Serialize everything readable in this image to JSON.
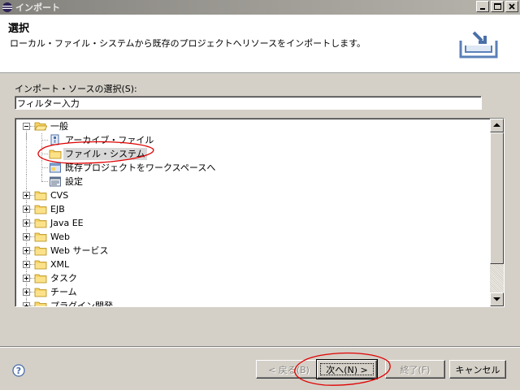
{
  "window": {
    "title": "インポート",
    "minimize_label": "_",
    "maximize_label": "□",
    "close_label": "X"
  },
  "banner": {
    "title": "選択",
    "description": "ローカル・ファイル・システムから既存のプロジェクトへリソースをインポートします。"
  },
  "source": {
    "label": "インポート・ソースの選択(S):",
    "filter_value": "フィルター入力"
  },
  "tree": {
    "items": [
      {
        "label": "一般",
        "icon": "folder-open-icon",
        "level": 0,
        "expanded": true
      },
      {
        "label": "アーカイブ・ファイル",
        "icon": "archive-file-icon",
        "level": 1
      },
      {
        "label": "ファイル・システム",
        "icon": "folder-icon",
        "level": 1,
        "selected": true
      },
      {
        "label": "既存プロジェクトをワークスペースへ",
        "icon": "project-icon",
        "level": 1
      },
      {
        "label": "設定",
        "icon": "settings-icon",
        "level": 1
      },
      {
        "label": "CVS",
        "icon": "folder-icon",
        "level": 0,
        "expanded": false
      },
      {
        "label": "EJB",
        "icon": "folder-icon",
        "level": 0,
        "expanded": false
      },
      {
        "label": "Java EE",
        "icon": "folder-icon",
        "level": 0,
        "expanded": false
      },
      {
        "label": "Web",
        "icon": "folder-icon",
        "level": 0,
        "expanded": false
      },
      {
        "label": "Web サービス",
        "icon": "folder-icon",
        "level": 0,
        "expanded": false
      },
      {
        "label": "XML",
        "icon": "folder-icon",
        "level": 0,
        "expanded": false
      },
      {
        "label": "タスク",
        "icon": "folder-icon",
        "level": 0,
        "expanded": false
      },
      {
        "label": "チーム",
        "icon": "folder-icon",
        "level": 0,
        "expanded": false
      },
      {
        "label": "プラグイン開発",
        "icon": "folder-icon",
        "level": 0,
        "expanded": false
      }
    ]
  },
  "buttons": {
    "back": "< 戻る(B)",
    "next": "次へ(N) >",
    "finish": "終了(F)",
    "cancel": "キャンセル",
    "help": "?"
  },
  "colors": {
    "annotation": "#e00000",
    "selection": "#d8d8d8",
    "folder": "#f2c94c"
  }
}
